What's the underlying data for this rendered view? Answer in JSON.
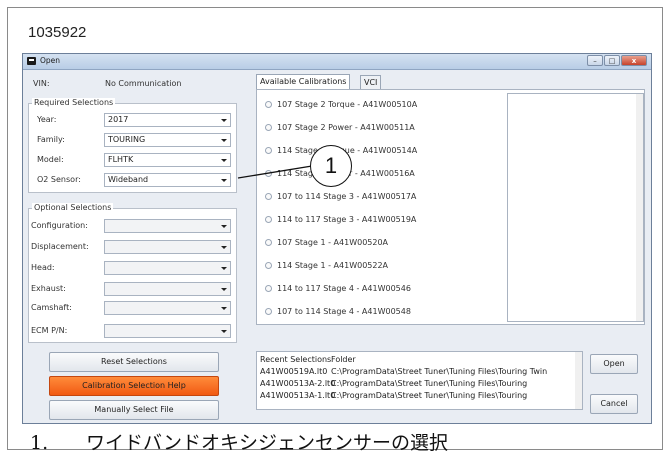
{
  "doc_id": "1035922",
  "window": {
    "title": "Open",
    "controls": [
      "minimize",
      "maximize",
      "close"
    ]
  },
  "vin": {
    "label": "VIN:",
    "value": "No Communication"
  },
  "required": {
    "title": "Required Selections",
    "fields": [
      {
        "label": "Year:",
        "value": "2017"
      },
      {
        "label": "Family:",
        "value": "TOURING"
      },
      {
        "label": "Model:",
        "value": "FLHTK"
      },
      {
        "label": "O2 Sensor:",
        "value": "Wideband"
      }
    ]
  },
  "optional": {
    "title": "Optional Selections",
    "fields": [
      {
        "label": "Configuration:",
        "value": ""
      },
      {
        "label": "Displacement:",
        "value": ""
      },
      {
        "label": "Head:",
        "value": ""
      },
      {
        "label": "Exhaust:",
        "value": ""
      },
      {
        "label": "Camshaft:",
        "value": ""
      },
      {
        "label": "ECM P/N:",
        "value": ""
      }
    ]
  },
  "buttons": {
    "reset": "Reset Selections",
    "help": "Calibration Selection Help",
    "manual": "Manually Select File",
    "open": "Open",
    "cancel": "Cancel"
  },
  "tabs": [
    "Available Calibrations",
    "VCI"
  ],
  "calibrations": [
    "107 Stage 2 Torque - A41W00510A",
    "107 Stage 2 Power - A41W00511A",
    "114 Stage 2 Torque - A41W00514A",
    "114 Stage 2 Power - A41W00516A",
    "107 to 114 Stage 3 - A41W00517A",
    "114 to 117 Stage 3 - A41W00519A",
    "107 Stage 1 - A41W00520A",
    "114 Stage 1 - A41W00522A",
    "114 to 117 Stage 4 - A41W00546",
    "107 to 114 Stage 4 - A41W00548"
  ],
  "recent": {
    "headers": [
      "Recent Selections",
      "Folder"
    ],
    "rows": [
      [
        "A41W00519A.lt0",
        "C:\\ProgramData\\Street Tuner\\Tuning Files\\Touring Twin"
      ],
      [
        "A41W00513A-2.lt0",
        "C:\\ProgramData\\Street Tuner\\Tuning Files\\Touring"
      ],
      [
        "A41W00513A-1.lt0",
        "C:\\ProgramData\\Street Tuner\\Tuning Files\\Touring"
      ]
    ]
  },
  "callout": {
    "number": "1"
  },
  "caption": {
    "number": "1.",
    "text": "ワイドバンドオキシジェンセンサーの選択"
  },
  "colors": {
    "help_button": "#f26a1f",
    "titlebar": "#c6d7ec"
  }
}
